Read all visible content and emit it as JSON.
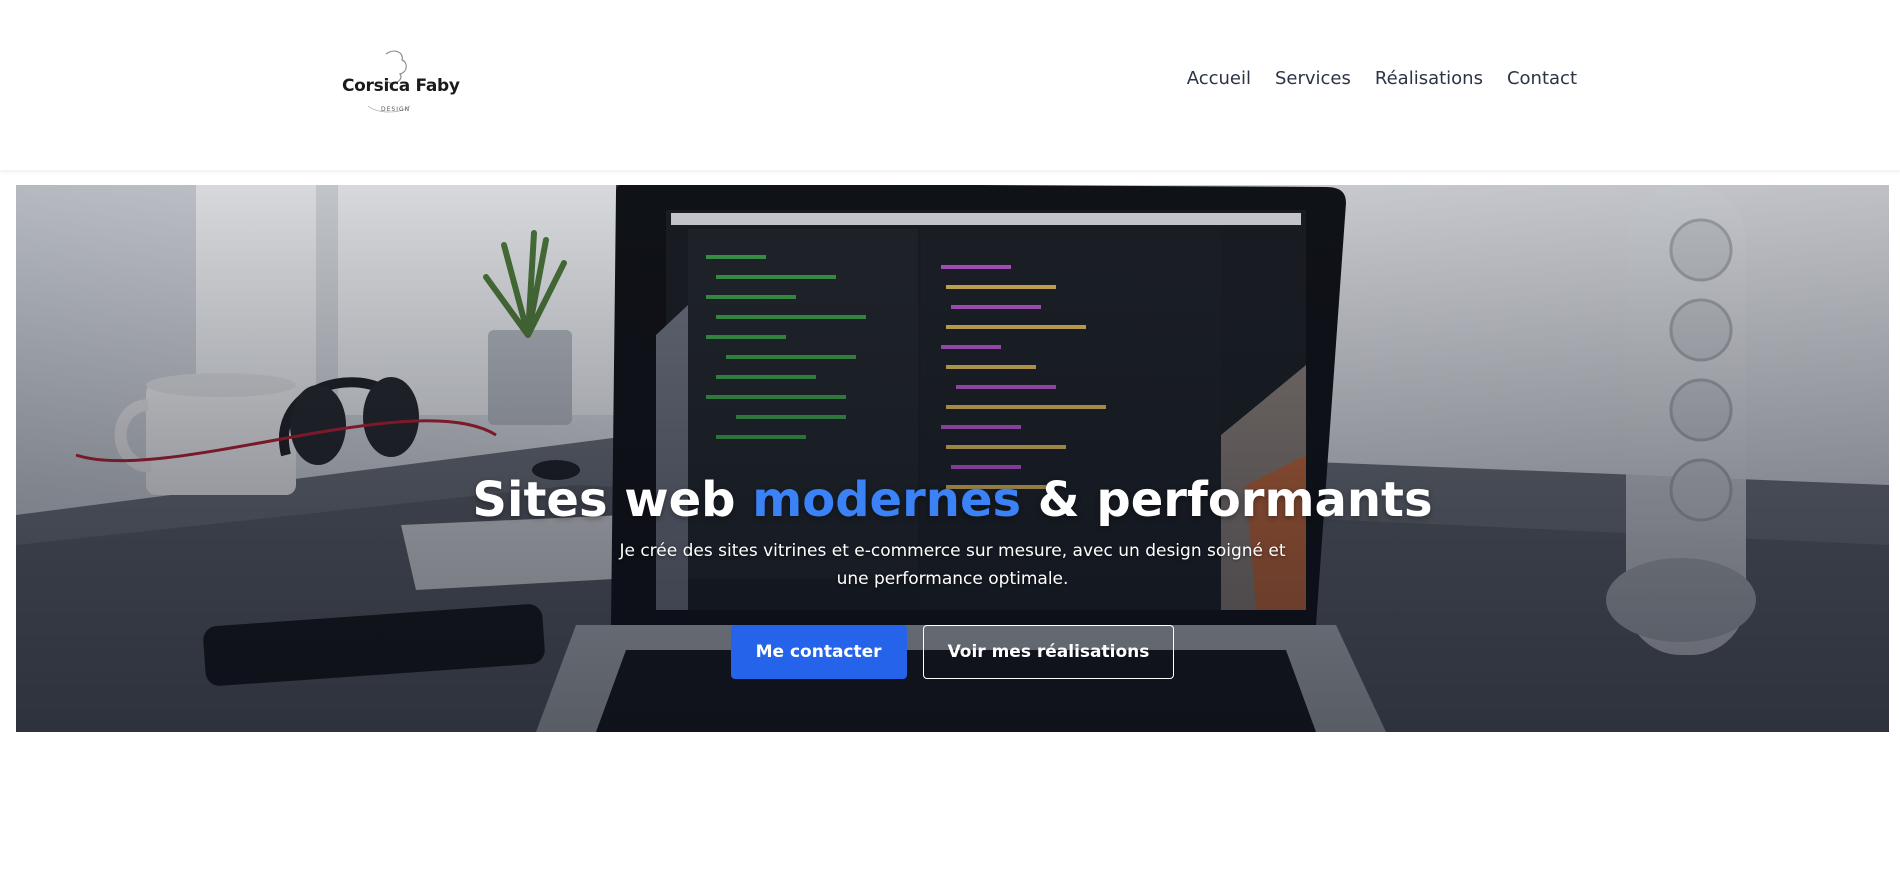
{
  "header": {
    "logo": {
      "name": "Corsica Faby",
      "sub": "DESIGN"
    },
    "nav": [
      {
        "label": "Accueil"
      },
      {
        "label": "Services"
      },
      {
        "label": "Réalisations"
      },
      {
        "label": "Contact"
      }
    ]
  },
  "hero": {
    "title_part1": "Sites web ",
    "title_accent": "modernes",
    "title_part2": " & performants",
    "subtitle": "Je crée des sites vitrines et e-commerce sur mesure, avec un design soigné et une performance optimale.",
    "primary_button": "Me contacter",
    "secondary_button": "Voir mes réalisations"
  },
  "colors": {
    "accent": "#3b82f6",
    "primary_button": "#2563eb",
    "nav_text": "#2b3445"
  }
}
